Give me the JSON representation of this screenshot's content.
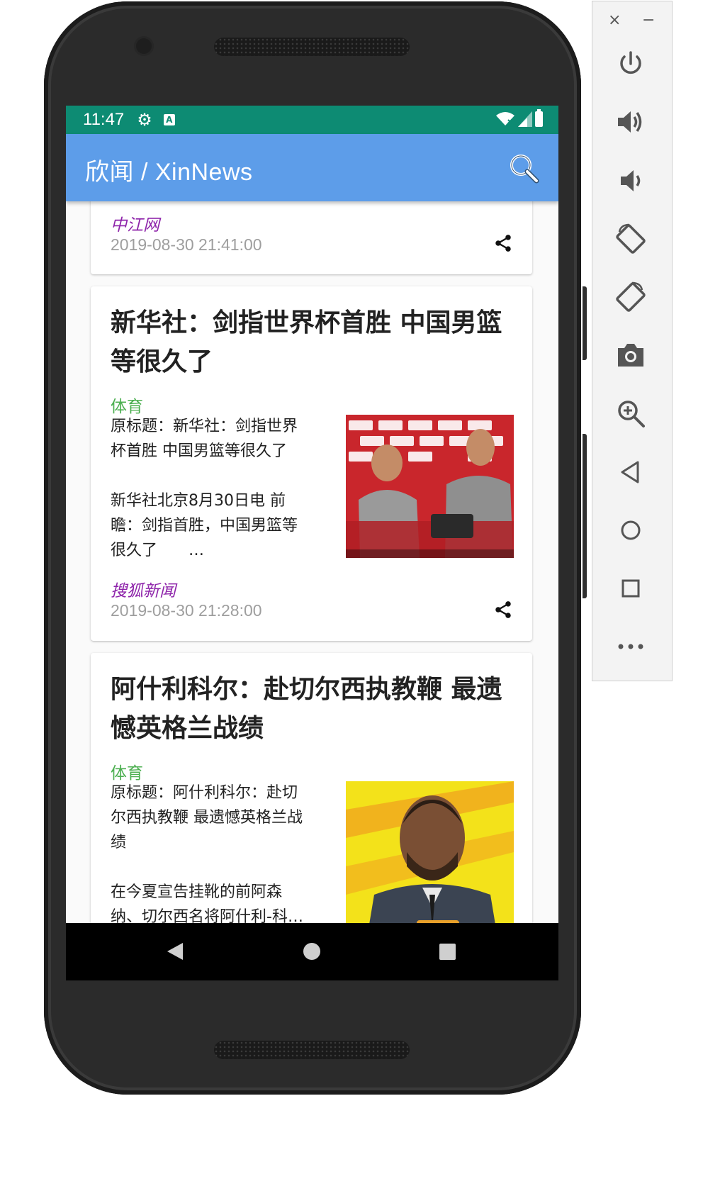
{
  "status_bar": {
    "time": "11:47",
    "a_badge": "A"
  },
  "app_bar": {
    "title": "欣闻 / XinNews"
  },
  "articles": [
    {
      "source": "中江网",
      "time": "2019-08-30 21:41:00"
    },
    {
      "title": "新华社：剑指世界杯首胜 中国男篮等很久了",
      "category": "体育",
      "summary": "原标题：新华社：剑指世界\n杯首胜 中国男篮等很久了\n\n新华社北京8月30日电 前\n瞻：剑指首胜，中国男篮等\n很久了　　…",
      "source": "搜狐新闻",
      "time": "2019-08-30 21:28:00"
    },
    {
      "title": "阿什利科尔：赴切尔西执教鞭 最遗憾英格兰战绩",
      "category": "体育",
      "summary": "原标题：阿什利科尔：赴切\n尔西执教鞭 最遗憾英格兰战\n绩\n\n在今夏宣告挂靴的前阿森\n纳、切尔西名将阿什利-科…"
    }
  ],
  "colors": {
    "status_bar": "#0d8b73",
    "app_bar": "#5d9de9",
    "category": "#4caf50",
    "source": "#8e24aa",
    "time": "#9e9e9e"
  },
  "emulator_panel": {
    "close_glyph": "×",
    "minimize_glyph": "−",
    "buttons": [
      "power-icon",
      "volume-up-icon",
      "volume-down-icon",
      "rotate-left-icon",
      "rotate-right-icon",
      "camera-icon",
      "zoom-icon",
      "back-icon",
      "home-icon",
      "overview-icon",
      "more-icon"
    ]
  }
}
